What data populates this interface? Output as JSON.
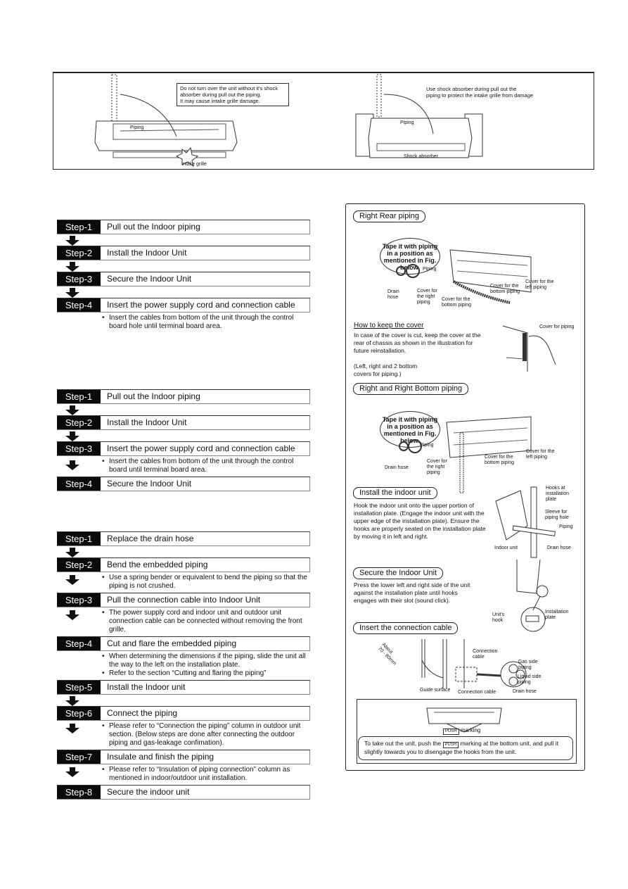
{
  "top_figure": {
    "left_note": "Do not turn over the unit without it's shock absorber during pull out the piping. It may cause intake grille damage.",
    "left_note_lines": [
      "Do not turn over the unit without it's shock",
      "absorber during pull out the piping.",
      "It may cause intake grille damage."
    ],
    "left_labels": {
      "piping": "Piping",
      "intake_grille": "Intake grille"
    },
    "right_note_lines": [
      "Use shock absorber during pull out the",
      "piping to protect the intake grille from damage"
    ],
    "right_labels": {
      "piping": "Piping",
      "shock_absorber": "Shock absorber"
    }
  },
  "flow_right_rear": {
    "steps": [
      {
        "tag": "Step-1",
        "text": "Pull out the Indoor piping",
        "notes": []
      },
      {
        "tag": "Step-2",
        "text": "Install the Indoor Unit",
        "notes": []
      },
      {
        "tag": "Step-3",
        "text": "Secure the Indoor Unit",
        "notes": []
      },
      {
        "tag": "Step-4",
        "text": "Insert the power supply cord and connection cable",
        "notes": [
          "Insert the cables from bottom of the unit through the control board hole until terminal board area."
        ]
      }
    ]
  },
  "flow_right_bottom": {
    "steps": [
      {
        "tag": "Step-1",
        "text": "Pull out the Indoor piping",
        "notes": []
      },
      {
        "tag": "Step-2",
        "text": "Install the Indoor Unit",
        "notes": []
      },
      {
        "tag": "Step-3",
        "text": "Insert the power supply cord and connection cable",
        "notes": [
          "Insert the cables from bottom of the unit through the control board until terminal board area."
        ]
      },
      {
        "tag": "Step-4",
        "text": "Secure the Indoor Unit",
        "notes": []
      }
    ]
  },
  "flow_embedded": {
    "steps": [
      {
        "tag": "Step-1",
        "text": "Replace the drain hose",
        "notes": []
      },
      {
        "tag": "Step-2",
        "text": "Bend the embedded piping",
        "notes": [
          "Use a spring bender or equivalent to bend the piping so that the piping is not crushed."
        ]
      },
      {
        "tag": "Step-3",
        "text": "Pull the connection cable into Indoor Unit",
        "notes": [
          "The power supply cord and indoor unit and outdoor unit connection cable can be connected without removing the front grille."
        ]
      },
      {
        "tag": "Step-4",
        "text": "Cut and flare the embedded piping",
        "notes": [
          "When determining the dimensions if the piping, slide the unit all the way to the left on the installation plate.",
          "Refer to the section “Cutting and flaring the piping”"
        ]
      },
      {
        "tag": "Step-5",
        "text": "Install the Indoor unit",
        "notes": []
      },
      {
        "tag": "Step-6",
        "text": "Connect the piping",
        "notes": [
          "Please refer to “Connection the piping” column in outdoor  unit section. (Below steps are done after connecting the outdoor piping and  gas-leakage confimation)."
        ]
      },
      {
        "tag": "Step-7",
        "text": "Insulate and finish the piping",
        "notes": [
          "Please refer to “Insulation of piping connection” column as mentioned in indoor/outdoor unit installation."
        ]
      },
      {
        "tag": "Step-8",
        "text": "Secure the indoor unit",
        "notes": []
      }
    ]
  },
  "right_panel": {
    "right_rear": {
      "title": "Right Rear piping",
      "cloud": [
        "Tape it with piping",
        "in a position as",
        "mentioned in Fig.",
        "below."
      ],
      "labels": {
        "piping": "Piping",
        "drain_hose": "Drain\nhose",
        "cover_right": "Cover for\nthe right\npiping",
        "cover_bottom_1": "Cover for the\nbottom piping",
        "cover_bottom_2": "Cover for the\nbottom piping",
        "cover_left": "Cover for the\nleft piping"
      }
    },
    "keep_cover": {
      "heading": "How to keep the cover",
      "text": "In case of the cover is cut, keep the cover at the rear of chassis as shown in the illustration for future reinstallation.",
      "note": "(Left, right and 2 bottom covers for piping.)",
      "label": "Cover for piping"
    },
    "right_bottom": {
      "title": "Right and Right Bottom piping",
      "cloud": [
        "Tape it with piping",
        "in a position as",
        "mentioned in Fig.",
        "below."
      ],
      "labels": {
        "piping": "Piping",
        "drain_hose": "Drain hose",
        "cover_right": "Cover for\nthe right\npiping",
        "cover_bottom": "Cover for the\nbottom piping",
        "cover_left": "Cover for the\nleft piping"
      }
    },
    "install_unit": {
      "title": "Install the indoor unit",
      "text": "Hook the indoor unit onto the upper portion of installation plate. (Engage the indoor unit with the upper edge of the installation plate). Ensure the hooks are properly seated on the installation plate by moving it in left and right.",
      "labels": {
        "hooks": "Hooks at\ninstallation\nplate",
        "sleeve": "Sleeve for\npiping hole",
        "piping": "Piping",
        "indoor_unit": "Indoor unit",
        "drain_hose": "Drain hose"
      }
    },
    "secure_unit": {
      "title": "Secure the Indoor Unit",
      "text": "Press the lower left and right side of the unit against the installation plate until hooks engages with their slot (sound click).",
      "labels": {
        "units_hook": "Unit's\nhook",
        "installation_plate": "Installation\nplate"
      }
    },
    "connection_cable": {
      "title": "Insert the connection cable",
      "labels": {
        "about": "About\n70 - 80mm",
        "guide": "Guide surface",
        "conn_cable_bottom": "Connection cable",
        "conn_cable": "Connection\ncable",
        "gas": "Gas side\npiping",
        "liquid": "Liquid side\npiping",
        "drain": "Drain hose"
      }
    },
    "push": {
      "marking_label": "marking",
      "tag": "PUSH",
      "note_before": "To take out the unit, push the",
      "note_after": "marking at the bottom  unit,  and pull  it  slightly  towards  you  to disengage the hooks from the unit."
    }
  }
}
